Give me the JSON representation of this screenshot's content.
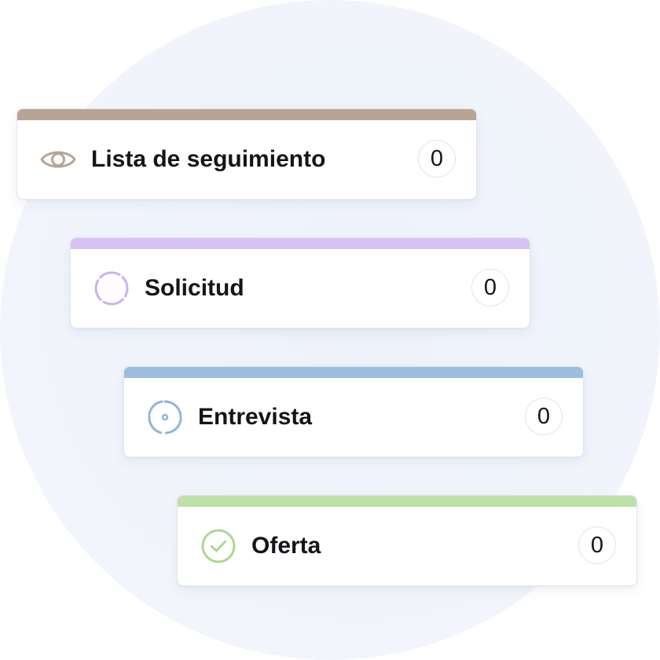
{
  "pipeline": {
    "stages": [
      {
        "label": "Lista de seguimiento",
        "count": "0",
        "icon": "eye-icon",
        "color": "#b8a494"
      },
      {
        "label": "Solicitud",
        "count": "0",
        "icon": "dashed-circle-icon",
        "color": "#d6c2f3"
      },
      {
        "label": "Entrevista",
        "count": "0",
        "icon": "target-icon",
        "color": "#9cbfde"
      },
      {
        "label": "Oferta",
        "count": "0",
        "icon": "check-circle-icon",
        "color": "#bde0a6"
      }
    ]
  }
}
